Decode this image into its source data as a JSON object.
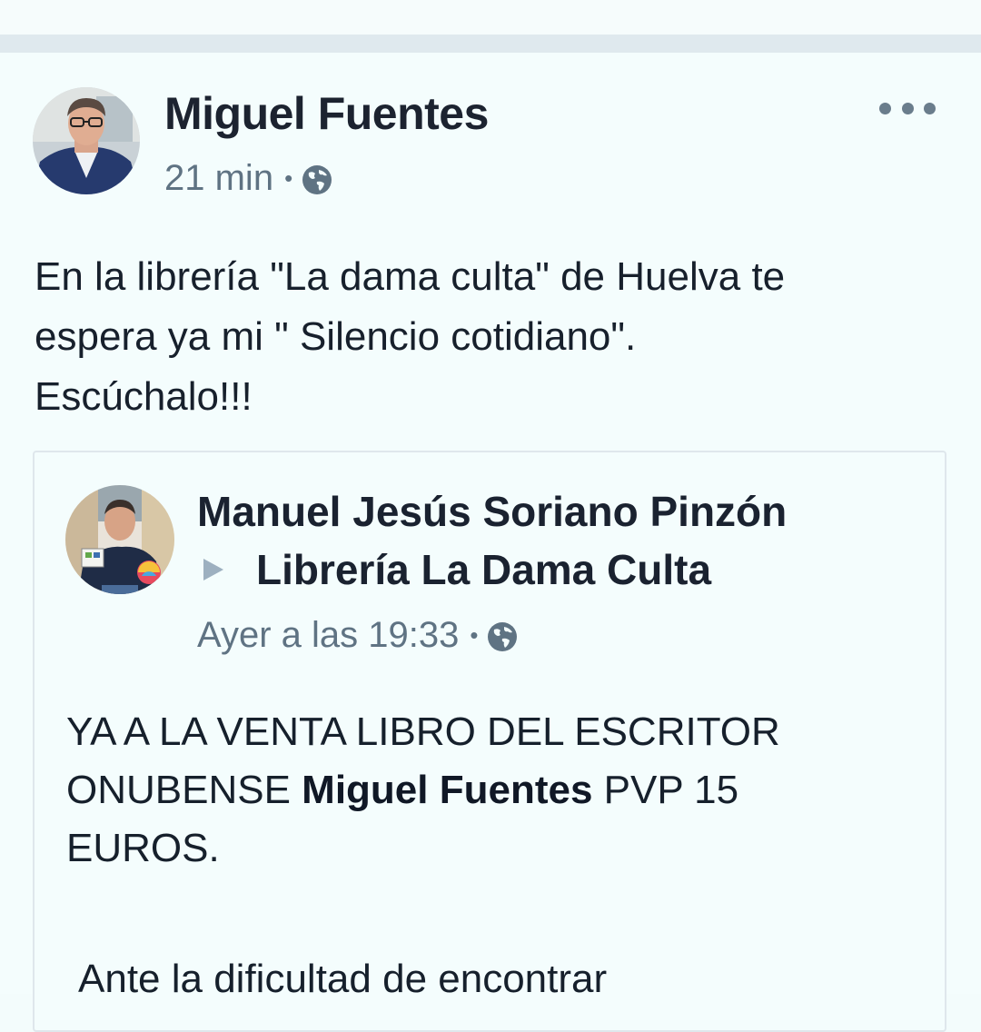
{
  "post": {
    "author": "Miguel Fuentes",
    "time": "21 min",
    "separator": "•",
    "privacy_icon": "globe-icon",
    "more_icon": "more-options-icon",
    "text_lines": [
      "En la librería \"La dama culta\" de Huelva te",
      "espera ya mi \" Silencio cotidiano\".",
      "Escúchalo!!!"
    ]
  },
  "shared_post": {
    "author": "Manuel Jesús Soriano Pinzón",
    "arrow_icon": "triangle-right-icon",
    "target": "Librería La Dama Culta",
    "time": "Ayer a las 19:33",
    "separator": "•",
    "privacy_icon": "globe-icon",
    "text": {
      "line1": "YA A LA VENTA LIBRO DEL ESCRITOR",
      "line2_before": "ONUBENSE ",
      "line2_bold": "Miguel Fuentes",
      "line2_after": " PVP 15",
      "line3": "EUROS.",
      "line4": "Ante la dificultad de encontrar"
    }
  },
  "colors": {
    "background": "#f4fdfd",
    "divider": "#dfe9ee",
    "text": "#17202c",
    "meta": "#5f7383",
    "arrow": "#9db0c0"
  }
}
